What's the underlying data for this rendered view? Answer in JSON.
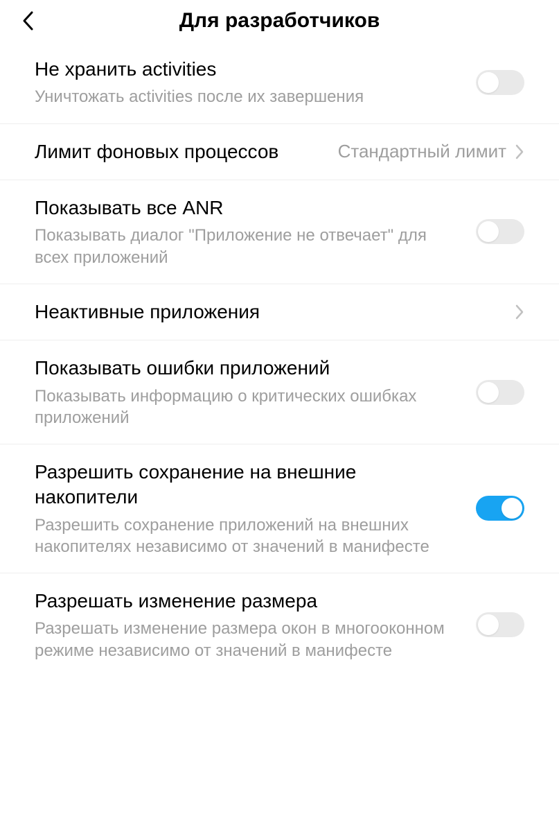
{
  "header": {
    "title": "Для разработчиков"
  },
  "rows": {
    "dont_keep_activities": {
      "title": "Не хранить activities",
      "sub": "Уничтожать activities после их завершения"
    },
    "bg_process_limit": {
      "title": "Лимит фоновых процессов",
      "value": "Стандартный лимит"
    },
    "show_all_anr": {
      "title": "Показывать все ANR",
      "sub": "Показывать диалог \"Приложение не отвечает\" для всех приложений"
    },
    "inactive_apps": {
      "title": "Неактивные приложения"
    },
    "show_app_errors": {
      "title": "Показывать ошибки приложений",
      "sub": "Показывать информацию о критических ошибках приложений"
    },
    "allow_external_save": {
      "title": "Разрешить сохранение на внешние накопители",
      "sub": "Разрешить сохранение приложений на внешних накопителях независимо от значений в манифесте"
    },
    "allow_resize": {
      "title": "Разрешать изменение размера",
      "sub": "Разрешать изменение размера окон в многооконном режиме независимо от значений в манифесте"
    }
  }
}
